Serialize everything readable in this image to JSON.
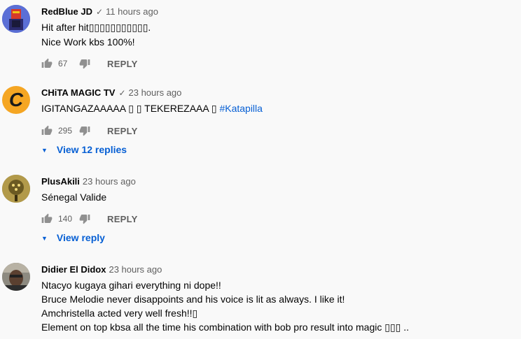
{
  "icons": {
    "like": "thumb-up-icon",
    "dislike": "thumb-down-icon",
    "verified": "check-icon",
    "expand": "caret-down-icon"
  },
  "colors": {
    "link": "#065fd4",
    "secondary_text": "#606060",
    "background": "#f9f9f9"
  },
  "comments": [
    {
      "author": "RedBlue JD",
      "verified_mark": "✓",
      "time": "11 hours ago",
      "lines": [
        "Hit after hit▯▯▯▯▯▯▯▯▯▯▯.",
        "Nice Work kbs 100%!"
      ],
      "likes": "67",
      "reply_label": "REPLY"
    },
    {
      "author": "CHiTA MAGIC TV",
      "verified_mark": "✓",
      "time": "23 hours ago",
      "text_main": "IGITANGAZAAAAA ▯ ▯ TEKEREZAAA  ▯ ",
      "hashtag": "#Katapilla",
      "likes": "295",
      "reply_label": "REPLY",
      "view_replies": "View 12 replies",
      "avatar_letter": "C"
    },
    {
      "author": "PlusAkili",
      "time": "23 hours ago",
      "lines": [
        "Sénegal Valide"
      ],
      "likes": "140",
      "reply_label": "REPLY",
      "view_replies": "View reply"
    },
    {
      "author": "Didier El Didox",
      "time": "23 hours ago",
      "lines": [
        "Ntacyo kugaya gihari everything ni dope!!",
        "Bruce Melodie never disappoints and his voice is lit as always. I like it!",
        "Amchristella acted very well fresh!!▯",
        "Element on top kbsa all the time his combination with bob pro result into magic ▯▯▯ .."
      ]
    }
  ]
}
